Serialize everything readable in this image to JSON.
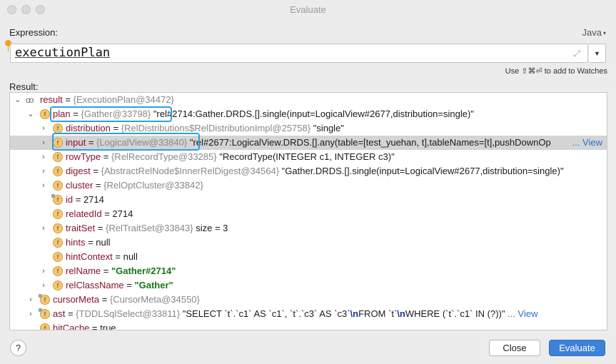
{
  "window": {
    "title": "Evaluate"
  },
  "expression": {
    "label": "Expression:",
    "language": "Java",
    "value": "executionPlan",
    "hint": "Use ⇧⌘⏎ to add to Watches"
  },
  "result": {
    "label": "Result:",
    "rows": [
      {
        "name": "result",
        "ref": "{ExecutionPlan@34472}",
        "value": ""
      },
      {
        "name": "plan",
        "ref": "{Gather@33798}",
        "value": "\"rel#2714:Gather.DRDS.[].single(input=LogicalView#2677,distribution=single)\""
      },
      {
        "name": "distribution",
        "ref": "{RelDistributions$RelDistributionImpl@25758}",
        "value": "\"single\""
      },
      {
        "name": "input",
        "ref": "{LogicalView@33840}",
        "value": "\"rel#2677:LogicalView.DRDS.[].any(table=[test_yuehan, t],tableNames=[t],pushDownOp",
        "link": "... View"
      },
      {
        "name": "rowType",
        "ref": "{RelRecordType@33285}",
        "value": "\"RecordType(INTEGER c1, INTEGER c3)\""
      },
      {
        "name": "digest",
        "ref": "{AbstractRelNode$InnerRelDigest@34564}",
        "value": "\"Gather.DRDS.[].single(input=LogicalView#2677,distribution=single)\""
      },
      {
        "name": "cluster",
        "ref": "{RelOptCluster@33842}",
        "value": ""
      },
      {
        "name": "id",
        "ref": "",
        "value": "2714"
      },
      {
        "name": "relatedId",
        "ref": "",
        "value": "2714"
      },
      {
        "name": "traitSet",
        "ref": "{RelTraitSet@33843}",
        "value": "size = 3"
      },
      {
        "name": "hints",
        "ref": "",
        "value": "null"
      },
      {
        "name": "hintContext",
        "ref": "",
        "value": "null"
      },
      {
        "name": "relName",
        "ref": "",
        "value": "\"Gather#2714\""
      },
      {
        "name": "relClassName",
        "ref": "",
        "value": "\"Gather\""
      },
      {
        "name": "cursorMeta",
        "ref": "{CursorMeta@34550}",
        "value": ""
      },
      {
        "name": "ast",
        "ref": "{TDDLSqlSelect@33811}",
        "value_parts": [
          "\"SELECT `t`.`c1` AS `c1`, `t`.`c3` AS `c3`",
          "\\n",
          "FROM `t`",
          "\\n",
          "WHERE (`t`.`c1` IN (?))\""
        ],
        "link": "... View"
      },
      {
        "name": "hitCache",
        "ref": "",
        "value": "true"
      }
    ]
  },
  "buttons": {
    "help": "?",
    "close": "Close",
    "evaluate": "Evaluate"
  },
  "icons": {
    "field": "f",
    "watch": "oo",
    "expanded": "chevron-down-icon",
    "collapsed": "chevron-right-icon"
  },
  "colors": {
    "accent": "#3d82d8",
    "highlight": "#2aa0e8",
    "field_name": "#87132c",
    "string_green": "#177516"
  }
}
